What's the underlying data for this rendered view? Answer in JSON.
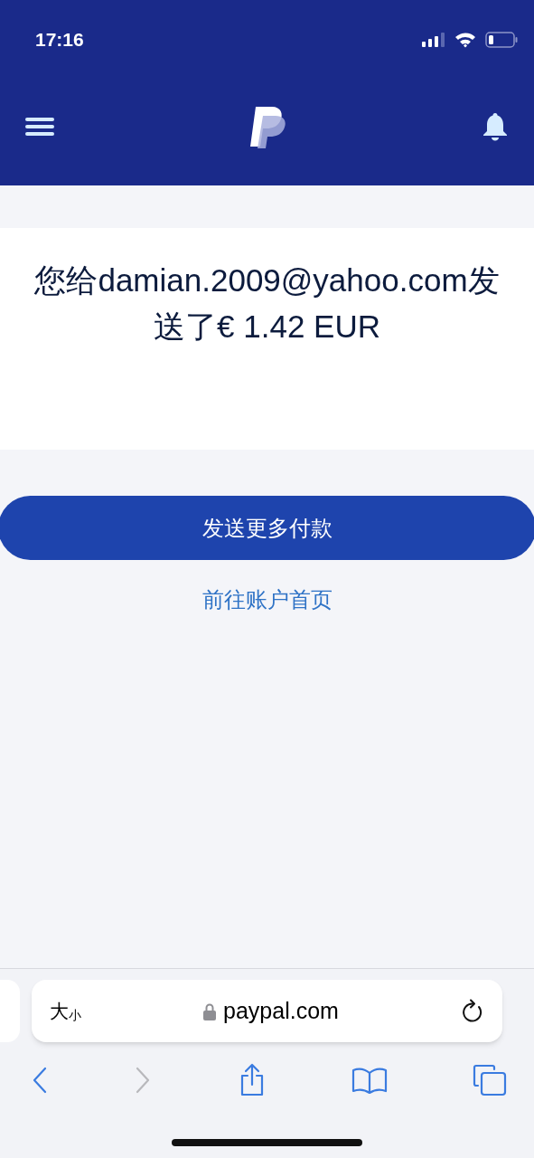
{
  "status_bar": {
    "time": "17:16"
  },
  "message": {
    "text": "您给damian.2009@yahoo.com发送了€ 1.42 EUR"
  },
  "primary_button": {
    "label": "发送更多付款"
  },
  "link": {
    "label": "前往账户首页"
  },
  "address_bar": {
    "text_size_large": "大",
    "text_size_small": "小",
    "url": "paypal.com"
  },
  "toolbar": [
    {
      "kind": "back",
      "disabled": false
    },
    {
      "kind": "forward",
      "disabled": true
    },
    {
      "kind": "share",
      "disabled": false
    },
    {
      "kind": "bookmarks",
      "disabled": false
    },
    {
      "kind": "tabs",
      "disabled": false
    }
  ]
}
